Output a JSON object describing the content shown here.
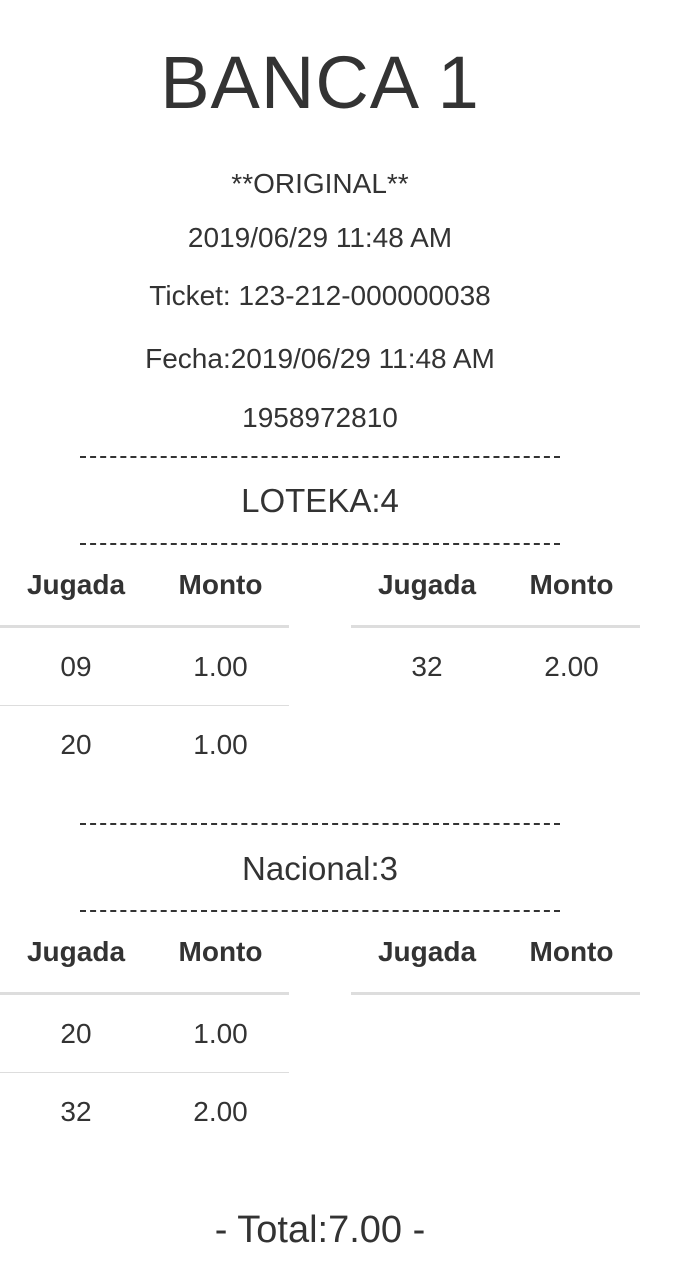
{
  "header": {
    "bank_name": "BANCA 1",
    "copy_label": "**ORIGINAL**",
    "datetime": "2019/06/29 11:48 AM",
    "ticket": "Ticket: 123-212-000000038",
    "fecha": "Fecha:2019/06/29 11:48 AM",
    "code": "1958972810"
  },
  "sections": [
    {
      "name": "LOTEKA:4",
      "col_jugada": "Jugada",
      "col_monto": "Monto",
      "left_rows": [
        {
          "jugada": "09",
          "monto": "1.00"
        },
        {
          "jugada": "20",
          "monto": "1.00"
        }
      ],
      "right_rows": [
        {
          "jugada": "32",
          "monto": "2.00"
        }
      ]
    },
    {
      "name": "Nacional:3",
      "col_jugada": "Jugada",
      "col_monto": "Monto",
      "left_rows": [
        {
          "jugada": "20",
          "monto": "1.00"
        },
        {
          "jugada": "32",
          "monto": "2.00"
        }
      ],
      "right_rows": []
    }
  ],
  "footer": {
    "total": "- Total:7.00 -"
  }
}
